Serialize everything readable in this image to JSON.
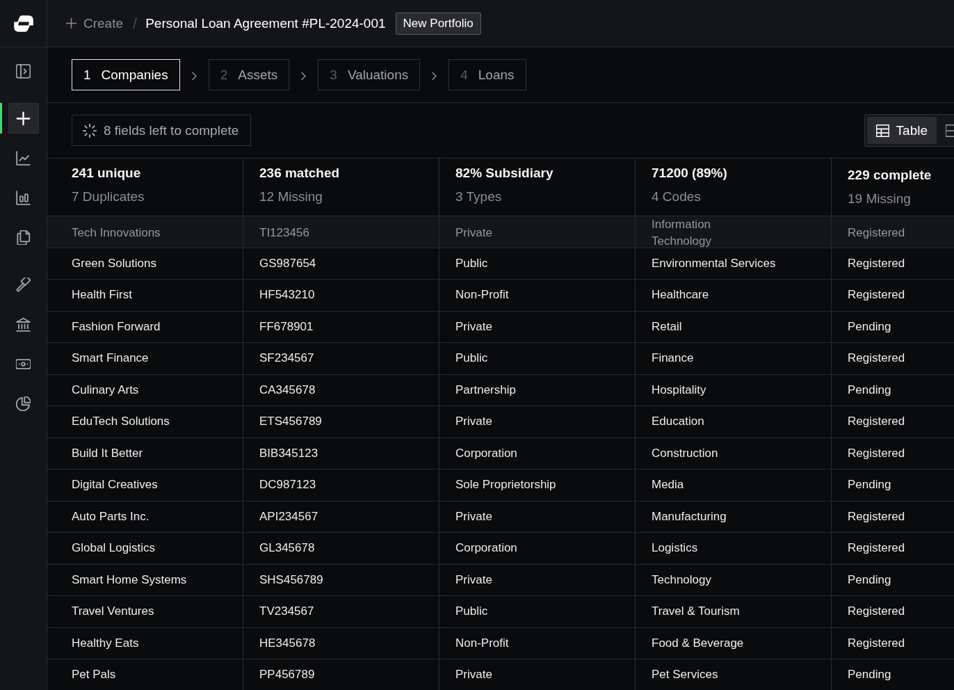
{
  "topbar": {
    "create_button": "Create",
    "breadcrumb_separator": "/",
    "title": "Personal Loan Agreement #PL-2024-001",
    "tag": "New Portfolio"
  },
  "sidebar": {
    "groups": [
      {
        "items": [
          {
            "selected": true
          },
          {
            "selected": false
          },
          {
            "selected": false
          },
          {
            "selected": false
          }
        ]
      },
      {
        "items": [
          {
            "selected": false
          },
          {
            "selected": false
          },
          {
            "selected": false
          },
          {
            "selected": false
          }
        ]
      }
    ]
  },
  "steps": [
    {
      "number": "1",
      "label": "Companies",
      "selected": true
    },
    {
      "number": "2",
      "label": "Assets",
      "selected": false
    },
    {
      "number": "3",
      "label": "Valuations",
      "selected": false
    },
    {
      "number": "4",
      "label": "Loans",
      "selected": false
    }
  ],
  "toolbar": {
    "status": "8 fields left to complete",
    "view_options": [
      {
        "kind": "table",
        "label": "Table",
        "selected": true
      },
      {
        "kind": "rows",
        "selected": false
      }
    ]
  },
  "stats": [
    {
      "value": "241 unique",
      "detail": "7 Duplicates"
    },
    {
      "value": "236 matched",
      "detail": "12 Missing"
    },
    {
      "value": "82% Subsidiary",
      "detail": "3 Types"
    },
    {
      "value": "71200 (89%)",
      "detail": "4 Codes"
    },
    {
      "value": "229 complete",
      "detail": "19 Missing"
    }
  ],
  "table": {
    "rows": [
      {
        "selected": true,
        "cells": [
          "Tech Innovations",
          "TI123456",
          "Private",
          "Information Technology",
          "Registered"
        ]
      },
      {
        "selected": false,
        "cells": [
          "Green Solutions",
          "GS987654",
          "Public",
          "Environmental Services",
          "Registered"
        ]
      },
      {
        "selected": false,
        "cells": [
          "Health First",
          "HF543210",
          "Non-Profit",
          "Healthcare",
          "Registered"
        ]
      },
      {
        "selected": false,
        "cells": [
          "Fashion Forward",
          "FF678901",
          "Private",
          "Retail",
          "Pending"
        ]
      },
      {
        "selected": false,
        "cells": [
          "Smart Finance",
          "SF234567",
          "Public",
          "Finance",
          "Registered"
        ]
      },
      {
        "selected": false,
        "cells": [
          "Culinary Arts",
          "CA345678",
          "Partnership",
          "Hospitality",
          "Pending"
        ]
      },
      {
        "selected": false,
        "cells": [
          "EduTech Solutions",
          "ETS456789",
          "Private",
          "Education",
          "Registered"
        ]
      },
      {
        "selected": false,
        "cells": [
          "Build It Better",
          "BIB345123",
          "Corporation",
          "Construction",
          "Registered"
        ]
      },
      {
        "selected": false,
        "cells": [
          "Digital Creatives",
          "DC987123",
          "Sole Proprietorship",
          "Media",
          "Pending"
        ]
      },
      {
        "selected": false,
        "cells": [
          "Auto Parts Inc.",
          "API234567",
          "Private",
          "Manufacturing",
          "Registered"
        ]
      },
      {
        "selected": false,
        "cells": [
          "Global Logistics",
          "GL345678",
          "Corporation",
          "Logistics",
          "Registered"
        ]
      },
      {
        "selected": false,
        "cells": [
          "Smart Home Systems",
          "SHS456789",
          "Private",
          "Technology",
          "Pending"
        ]
      },
      {
        "selected": false,
        "cells": [
          "Travel Ventures",
          "TV234567",
          "Public",
          "Travel & Tourism",
          "Registered"
        ]
      },
      {
        "selected": false,
        "cells": [
          "Healthy Eats",
          "HE345678",
          "Non-Profit",
          "Food & Beverage",
          "Registered"
        ]
      },
      {
        "selected": false,
        "cells": [
          "Pet Pals",
          "PP456789",
          "Private",
          "Pet Services",
          "Pending"
        ]
      }
    ]
  }
}
